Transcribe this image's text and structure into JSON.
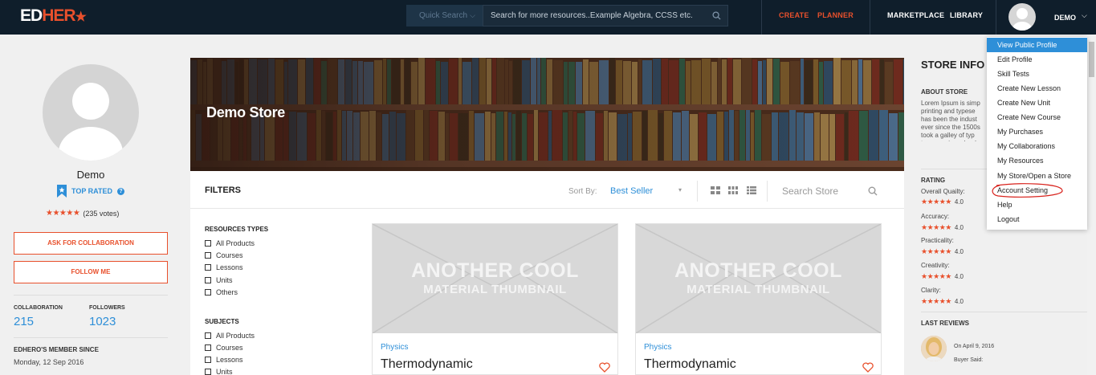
{
  "topbar": {
    "logo_ed": "ED",
    "logo_hero": "HER",
    "quick_search": "Quick Search",
    "search_placeholder": "Search for more resources..Example Algebra, CCSS etc.",
    "nav": {
      "create": "CREATE",
      "planner": "PLANNER",
      "marketplace": "MARKETPLACE",
      "library": "LIBRARY",
      "user": "DEMO"
    }
  },
  "profile": {
    "name": "Demo",
    "badge": "TOP RATED",
    "votes": "(235 votes)",
    "ask_collab": "ASK FOR COLLABORATION",
    "follow": "FOLLOW ME",
    "collab_label": "COLLABORATION",
    "collab_value": "215",
    "followers_label": "FOLLOWERS",
    "followers_value": "1023",
    "member_label": "EDHERO'S MEMBER SINCE",
    "member_value": "Monday, 12 Sep 2016"
  },
  "store": {
    "title": "Demo Store"
  },
  "toolbar": {
    "filters": "FILTERS",
    "sort_label": "Sort By:",
    "sort_value": "Best Seller",
    "search_placeholder": "Search Store"
  },
  "filters": {
    "resource_types": {
      "title": "RESOURCES TYPES",
      "items": [
        "All Products",
        "Courses",
        "Lessons",
        "Units",
        "Others"
      ]
    },
    "subjects": {
      "title": "SUBJECTS",
      "items": [
        "All Products",
        "Courses",
        "Lessons",
        "Units"
      ]
    }
  },
  "cards": [
    {
      "thumb_line1": "ANOTHER COOL",
      "thumb_line2": "MATERIAL THUMBNAIL",
      "category": "Physics",
      "title": "Thermodynamic"
    },
    {
      "thumb_line1": "ANOTHER COOL",
      "thumb_line2": "MATERIAL THUMBNAIL",
      "category": "Physics",
      "title": "Thermodynamic"
    }
  ],
  "store_info": {
    "title": "STORE INFO",
    "about_label": "ABOUT STORE",
    "about_text": "Lorem Ipsum is simp printing and typese has been the indust ever since the 1500s took a galley of typ type specimen book centuries",
    "rating_label": "RATING",
    "ratings": [
      {
        "label": "Overall Quailty:",
        "value": "4.0"
      },
      {
        "label": "Accuracy:",
        "value": "4.0"
      },
      {
        "label": "Practicality:",
        "value": "4.0"
      },
      {
        "label": "Creativity:",
        "value": "4.0"
      },
      {
        "label": "Clarity:",
        "value": "4.0"
      }
    ],
    "reviews_label": "LAST REVIEWS",
    "review_date": "On April 9, 2016",
    "review_by": "Buyer Said:"
  },
  "dropdown": {
    "items": [
      "View Public Profile",
      "Edit Profile",
      "Skill Tests",
      "Create New Lesson",
      "Create New Unit",
      "Create New Course",
      "My Purchases",
      "My Collaborations",
      "My Resources",
      "My Store/Open a Store",
      "Account Setting",
      "Help",
      "Logout"
    ]
  },
  "colors": {
    "brand": "#e8502c",
    "accent": "#2e8fd8",
    "topbar": "#0f1e2b"
  },
  "icons": [
    "star-icon",
    "search-icon",
    "chevron-down-icon",
    "bookmark-icon",
    "question-icon",
    "heart-icon",
    "grid-icon",
    "list-icon",
    "checkbox-icon"
  ]
}
